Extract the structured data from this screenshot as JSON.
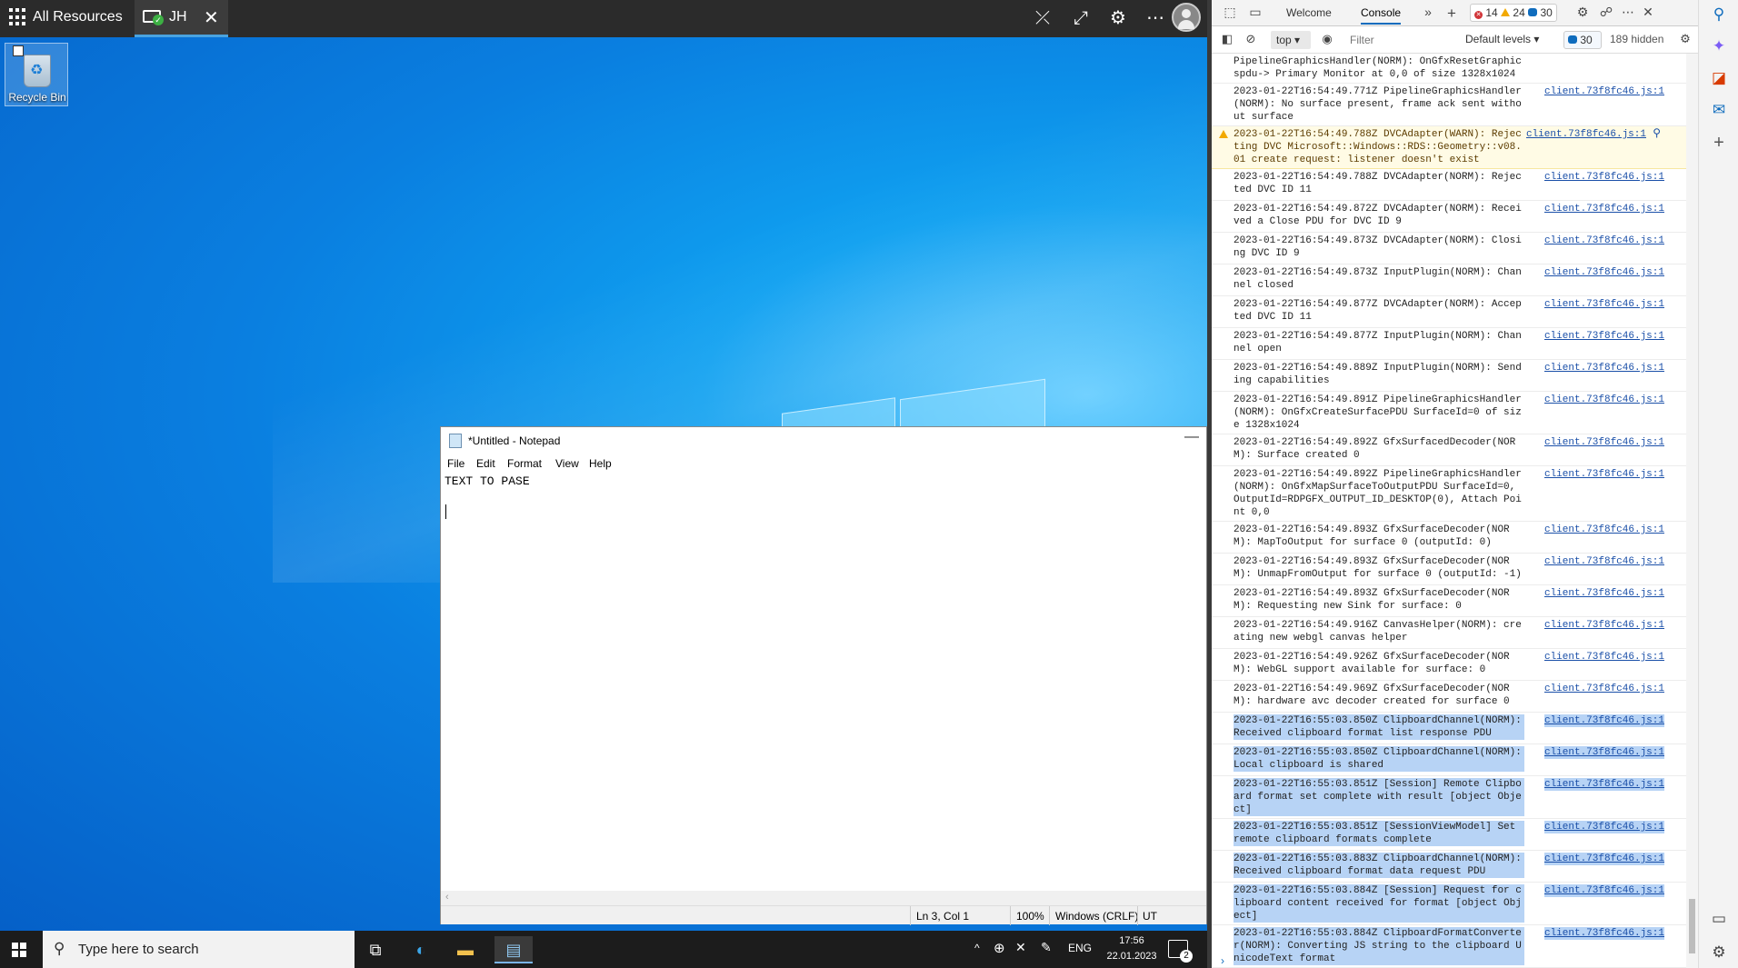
{
  "topbar": {
    "all_resources": "All Resources",
    "tab_name": "JH",
    "tab_close": "✕",
    "icons": [
      "pin-off-icon",
      "fullscreen-icon",
      "settings-icon",
      "more-icon",
      "user-avatar-icon"
    ]
  },
  "desktop": {
    "recycle_bin_label": "Recycle Bin"
  },
  "notepad": {
    "title": "*Untitled - Notepad",
    "minimize": "—",
    "menu": [
      "File",
      "Edit",
      "Format",
      "View",
      "Help"
    ],
    "content_line1": "TEXT TO PASE",
    "status": {
      "position": "Ln 3, Col 1",
      "zoom": "100%",
      "line_endings": "Windows (CRLF)",
      "encoding": "UT"
    }
  },
  "taskbar": {
    "search_placeholder": "Type here to search",
    "language": "ENG",
    "time": "17:56",
    "date": "22.01.2023",
    "notifications": "2"
  },
  "devtools": {
    "tabs": [
      "Welcome",
      "Console"
    ],
    "errors": "14",
    "warnings": "24",
    "info": "30",
    "context": "top",
    "filter_placeholder": "Filter",
    "levels": "Default levels",
    "message_count": "30",
    "hidden_count": "189 hidden",
    "messages": [
      {
        "text": "PipelineGraphicsHandler(NORM): OnGfxResetGraphicspdu-> Primary Monitor at 0,0 of size 1328x1024",
        "src": "",
        "type": "log",
        "selected": false
      },
      {
        "text": "2023-01-22T16:54:49.771Z PipelineGraphicsHandler(NORM): No surface present, frame ack sent without surface",
        "src": "client.73f8fc46.js:1",
        "type": "log",
        "selected": false
      },
      {
        "text": "2023-01-22T16:54:49.788Z DVCAdapter(WARN): Rejecting DVC Microsoft::Windows::RDS::Geometry::v08.01 create request: listener doesn't exist",
        "src": "client.73f8fc46.js:1",
        "type": "warn",
        "selected": false
      },
      {
        "text": "2023-01-22T16:54:49.788Z DVCAdapter(NORM): Rejected DVC ID 11",
        "src": "client.73f8fc46.js:1",
        "type": "log",
        "selected": false
      },
      {
        "text": "2023-01-22T16:54:49.872Z DVCAdapter(NORM): Received a Close PDU for DVC ID 9",
        "src": "client.73f8fc46.js:1",
        "type": "log",
        "selected": false
      },
      {
        "text": "2023-01-22T16:54:49.873Z DVCAdapter(NORM): Closing DVC ID 9",
        "src": "client.73f8fc46.js:1",
        "type": "log",
        "selected": false
      },
      {
        "text": "2023-01-22T16:54:49.873Z InputPlugin(NORM): Channel closed",
        "src": "client.73f8fc46.js:1",
        "type": "log",
        "selected": false
      },
      {
        "text": "2023-01-22T16:54:49.877Z DVCAdapter(NORM): Accepted DVC ID 11",
        "src": "client.73f8fc46.js:1",
        "type": "log",
        "selected": false
      },
      {
        "text": "2023-01-22T16:54:49.877Z InputPlugin(NORM): Channel open",
        "src": "client.73f8fc46.js:1",
        "type": "log",
        "selected": false
      },
      {
        "text": "2023-01-22T16:54:49.889Z InputPlugin(NORM): Sending capabilities",
        "src": "client.73f8fc46.js:1",
        "type": "log",
        "selected": false
      },
      {
        "text": "2023-01-22T16:54:49.891Z PipelineGraphicsHandler(NORM): OnGfxCreateSurfacePDU SurfaceId=0 of size 1328x1024",
        "src": "client.73f8fc46.js:1",
        "type": "log",
        "selected": false
      },
      {
        "text": "2023-01-22T16:54:49.892Z GfxSurfacedDecoder(NORM): Surface created 0",
        "src": "client.73f8fc46.js:1",
        "type": "log",
        "selected": false
      },
      {
        "text": "2023-01-22T16:54:49.892Z PipelineGraphicsHandler(NORM): OnGfxMapSurfaceToOutputPDU SurfaceId=0, OutputId=RDPGFX_OUTPUT_ID_DESKTOP(0), Attach Point 0,0",
        "src": "client.73f8fc46.js:1",
        "type": "log",
        "selected": false
      },
      {
        "text": "2023-01-22T16:54:49.893Z GfxSurfaceDecoder(NORM): MapToOutput for surface 0 (outputId: 0)",
        "src": "client.73f8fc46.js:1",
        "type": "log",
        "selected": false
      },
      {
        "text": "2023-01-22T16:54:49.893Z GfxSurfaceDecoder(NORM): UnmapFromOutput for surface 0 (outputId: -1)",
        "src": "client.73f8fc46.js:1",
        "type": "log",
        "selected": false
      },
      {
        "text": "2023-01-22T16:54:49.893Z GfxSurfaceDecoder(NORM): Requesting new Sink for surface: 0",
        "src": "client.73f8fc46.js:1",
        "type": "log",
        "selected": false
      },
      {
        "text": "2023-01-22T16:54:49.916Z CanvasHelper(NORM): creating new webgl canvas helper",
        "src": "client.73f8fc46.js:1",
        "type": "log",
        "selected": false
      },
      {
        "text": "2023-01-22T16:54:49.926Z GfxSurfaceDecoder(NORM): WebGL support available for surface: 0",
        "src": "client.73f8fc46.js:1",
        "type": "log",
        "selected": false
      },
      {
        "text": "2023-01-22T16:54:49.969Z GfxSurfaceDecoder(NORM): hardware avc decoder created for surface 0",
        "src": "client.73f8fc46.js:1",
        "type": "log",
        "selected": false
      },
      {
        "text": "2023-01-22T16:55:03.850Z ClipboardChannel(NORM): Received clipboard format list response PDU",
        "src": "client.73f8fc46.js:1",
        "type": "log",
        "selected": true
      },
      {
        "text": "2023-01-22T16:55:03.850Z ClipboardChannel(NORM): Local clipboard is shared",
        "src": "client.73f8fc46.js:1",
        "type": "log",
        "selected": true
      },
      {
        "text": "2023-01-22T16:55:03.851Z [Session] Remote Clipboard format set complete with result [object Object]",
        "src": "client.73f8fc46.js:1",
        "type": "log",
        "selected": true
      },
      {
        "text": "2023-01-22T16:55:03.851Z [SessionViewModel] Set remote clipboard formats complete",
        "src": "client.73f8fc46.js:1",
        "type": "log",
        "selected": true
      },
      {
        "text": "2023-01-22T16:55:03.883Z ClipboardChannel(NORM): Received clipboard format data request PDU",
        "src": "client.73f8fc46.js:1",
        "type": "log",
        "selected": true
      },
      {
        "text": "2023-01-22T16:55:03.884Z [Session] Request for clipboard content received for format [object Object]",
        "src": "client.73f8fc46.js:1",
        "type": "log",
        "selected": true
      },
      {
        "text": "2023-01-22T16:55:03.884Z ClipboardFormatConverter(NORM): Converting JS string to the clipboard UnicodeText format",
        "src": "client.73f8fc46.js:1",
        "type": "log",
        "selected": true
      }
    ],
    "prompt": "›"
  },
  "colors": {
    "accent": "#0f6cbd",
    "desktop_blue": "#0a7fe0",
    "selection": "#b7d3f5",
    "warning_bg": "#fffbe5"
  }
}
